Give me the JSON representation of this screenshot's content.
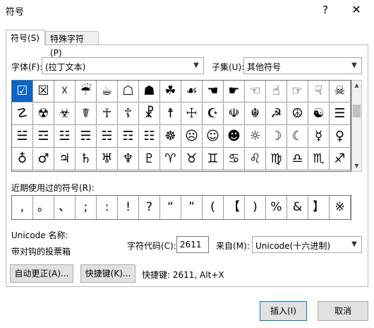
{
  "dialog": {
    "title": "符号",
    "help_label": "?",
    "close_label": "✕"
  },
  "tabs": [
    {
      "label": "符号(S)",
      "active": true
    },
    {
      "label": "特殊字符(P)",
      "active": false
    }
  ],
  "font": {
    "label": "字体(F):",
    "value": "(拉丁文本)"
  },
  "subset": {
    "label": "子集(U):",
    "value": "其他符号"
  },
  "symbol_grid": {
    "selected_index": 0,
    "rows": [
      [
        "☑",
        "☒",
        "☓",
        "☔",
        "☕",
        "☖",
        "☗",
        "☘",
        "☙",
        "☚",
        "☛",
        "☜",
        "☝",
        "☞",
        "☟",
        "☠"
      ],
      [
        "☡",
        "☢",
        "☣",
        "☤",
        "☥",
        "☦",
        "☧",
        "☨",
        "☩",
        "☪",
        "☫",
        "☬",
        "☭",
        "☮",
        "☯",
        "☰"
      ],
      [
        "☱",
        "☲",
        "☳",
        "☴",
        "☵",
        "☶",
        "☷",
        "☸",
        "☹",
        "☺",
        "☻",
        "☼",
        "☽",
        "☾",
        "☿",
        "♀"
      ],
      [
        "♁",
        "♂",
        "♃",
        "♄",
        "♅",
        "♆",
        "♇",
        "♈",
        "♉",
        "♊",
        "♋",
        "♌",
        "♍",
        "♎",
        "♏",
        "♐"
      ]
    ]
  },
  "recent": {
    "label": "近期使用过的符号(R):",
    "symbols": [
      ",",
      "。",
      "、",
      ";",
      ":",
      "!",
      "?",
      "“",
      "”",
      "(",
      "【",
      ")",
      "%",
      "&",
      "】",
      "※"
    ]
  },
  "unicode_name": {
    "label": "Unicode 名称:",
    "value": "带对钩的投票箱"
  },
  "char_code": {
    "label": "字符代码(C):",
    "value": "2611"
  },
  "from": {
    "label": "来自(M):",
    "value": "Unicode(十六进制)"
  },
  "buttons": {
    "autocorrect": "自动更正(A)...",
    "shortcut_key": "快捷键(K)...",
    "insert": "插入(I)",
    "cancel": "取消"
  },
  "shortcut_text": "快捷键: 2611, Alt+X",
  "icons": {
    "dropdown": "chevron-down-icon",
    "scroll_up": "scroll-up-icon",
    "scroll_down": "scroll-down-icon"
  },
  "colors": {
    "selection": "#0b64c8",
    "primary_border": "#0078d7"
  }
}
